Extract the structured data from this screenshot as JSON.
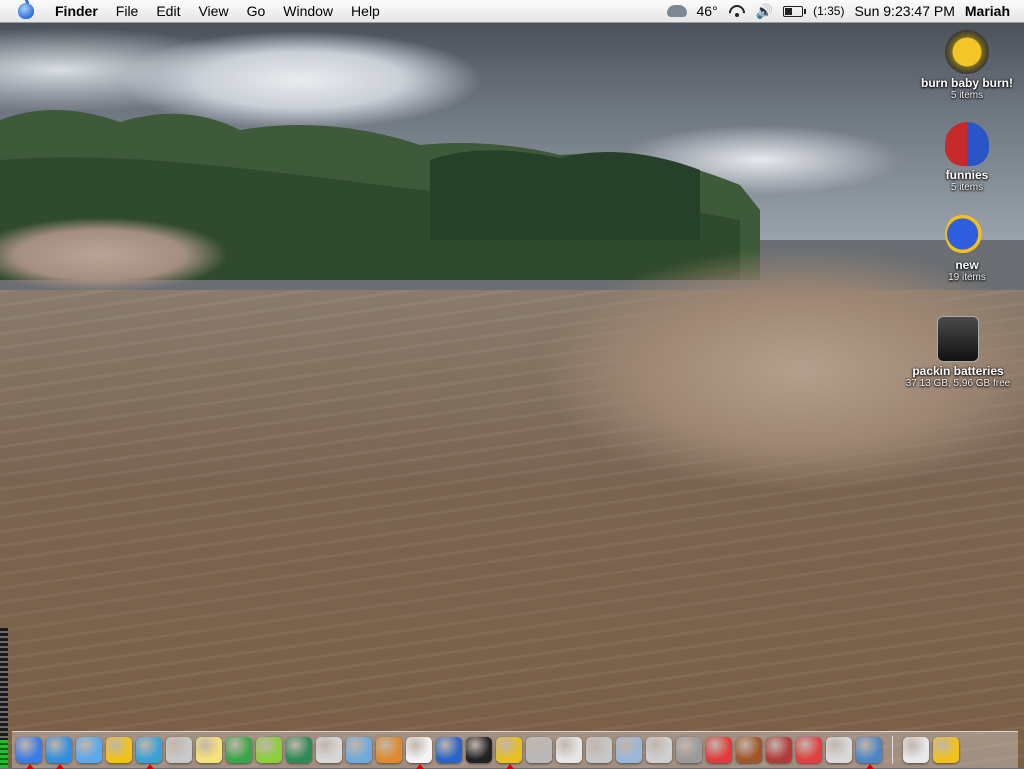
{
  "menubar": {
    "app": "Finder",
    "menus": [
      "File",
      "Edit",
      "View",
      "Go",
      "Window",
      "Help"
    ],
    "temperature": "46°",
    "battery_time": "(1:35)",
    "clock": "Sun 9:23:47 PM",
    "user": "Mariah"
  },
  "desktop_items": [
    {
      "name": "burn baby burn!",
      "sub": "5 items",
      "icon": "burn-folder-icon"
    },
    {
      "name": "funnies",
      "sub": "5 items",
      "icon": "funnies-folder-icon"
    },
    {
      "name": "new",
      "sub": "19 items",
      "icon": "fish-folder-icon"
    },
    {
      "name": "packin batteries",
      "sub": "37.13 GB, 5.96 GB free",
      "icon": "hard-drive-icon"
    }
  ],
  "dock": {
    "icons": [
      {
        "icon": "finder-icon",
        "color": "#3b7be8"
      },
      {
        "icon": "safari-icon",
        "color": "#2f8fe0"
      },
      {
        "icon": "ichat-icon",
        "color": "#57a9f0"
      },
      {
        "icon": "adium-duck-icon",
        "color": "#f2c21a"
      },
      {
        "icon": "users-icon",
        "color": "#3aa0d8"
      },
      {
        "icon": "magnifier-icon",
        "color": "#c9c9c9"
      },
      {
        "icon": "stickies-icon",
        "color": "#f6e27a"
      },
      {
        "icon": "globe-icon",
        "color": "#3aa64a"
      },
      {
        "icon": "flower-icon",
        "color": "#8bcf3c"
      },
      {
        "icon": "music-note-icon",
        "color": "#2e8b57"
      },
      {
        "icon": "mplayer-icon",
        "color": "#d7d7d7"
      },
      {
        "icon": "preview-icon",
        "color": "#6fa8dc"
      },
      {
        "icon": "iphoto-icon",
        "color": "#e08a2e"
      },
      {
        "icon": "ical-icon",
        "color": "#f4f4f4"
      },
      {
        "icon": "word-icon",
        "color": "#2a64c8"
      },
      {
        "icon": "terminal-icon",
        "color": "#222222"
      },
      {
        "icon": "color-wheel-icon",
        "color": "#e8c020"
      },
      {
        "icon": "mac-icon",
        "color": "#b9b9b9"
      },
      {
        "icon": "chess-icon",
        "color": "#e6e6e6"
      },
      {
        "icon": "dvd-player-icon",
        "color": "#c7c7c7"
      },
      {
        "icon": "dolphin-icon",
        "color": "#9bb7d8"
      },
      {
        "icon": "disk-utility-icon",
        "color": "#d0d0d0"
      },
      {
        "icon": "printer-icon",
        "color": "#9a9a9a"
      },
      {
        "icon": "print-cd-icon",
        "color": "#e23b3b"
      },
      {
        "icon": "clock-icon",
        "color": "#a0562a"
      },
      {
        "icon": "antenna-icon",
        "color": "#b23a3a"
      },
      {
        "icon": "thermometer-icon",
        "color": "#e04040"
      },
      {
        "icon": "apple-icon",
        "color": "#d9d9d9"
      },
      {
        "icon": "photo-browser-icon",
        "color": "#4c86c6"
      }
    ],
    "right_icons": [
      {
        "icon": "mail-tray-icon",
        "color": "#e9e9e9"
      },
      {
        "icon": "trash-icon",
        "color": "#f2c21a"
      }
    ],
    "running_indices": [
      0,
      1,
      4,
      13,
      16,
      28
    ]
  }
}
